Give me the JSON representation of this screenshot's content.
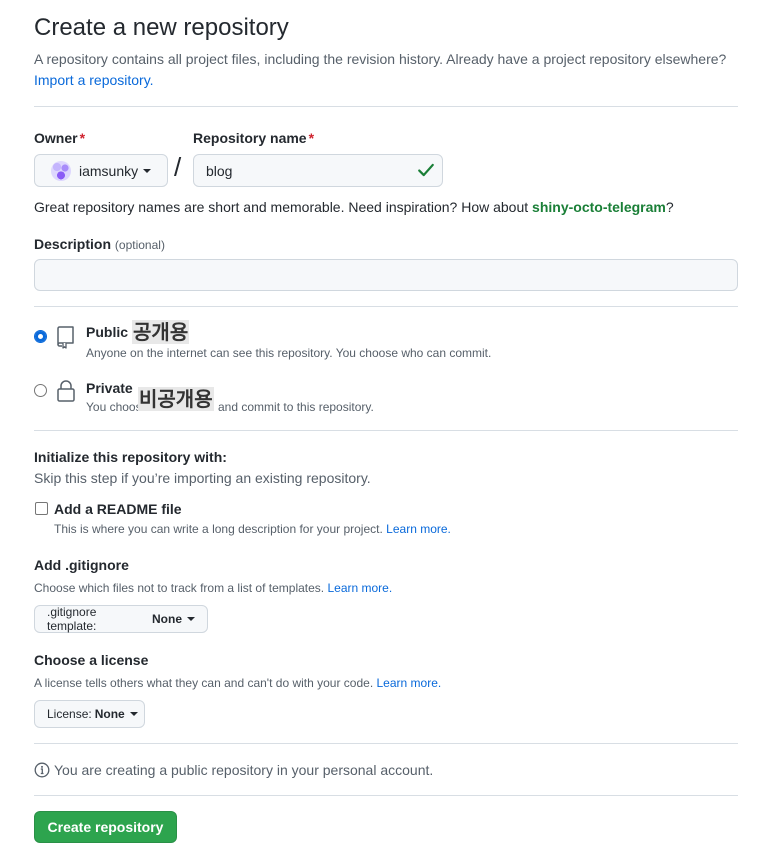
{
  "page": {
    "title": "Create a new repository",
    "subtitle": "A repository contains all project files, including the revision history. Already have a project repository elsewhere?",
    "import_link": "Import a repository."
  },
  "owner": {
    "label": "Owner",
    "required_mark": "*",
    "value": "iamsunky",
    "icon": "avatar"
  },
  "repo": {
    "separator": "/",
    "label": "Repository name",
    "required_mark": "*",
    "value": "blog",
    "valid_icon": "check-icon",
    "valid_color": "#1a7f37"
  },
  "name_hint": {
    "text": "Great repository names are short and memorable. Need inspiration? How about ",
    "suggestion": "shiny-octo-telegram",
    "end": "?"
  },
  "description": {
    "label": "Description",
    "optional": "(optional)",
    "value": ""
  },
  "visibility": {
    "options": [
      {
        "title": "Public",
        "overlay": "공개용",
        "desc": "Anyone on the internet can see this repository. You choose who can commit.",
        "selected": true,
        "icon": "repo-icon"
      },
      {
        "title": "Private",
        "overlay": "비공개용",
        "desc_before": "You choos",
        "desc_after": "and commit to this repository.",
        "selected": false,
        "icon": "lock-icon"
      }
    ]
  },
  "initialize": {
    "title": "Initialize this repository with:",
    "subtitle": "Skip this step if you’re importing an existing repository.",
    "readme": {
      "label": "Add a README file",
      "checked": false,
      "desc": "This is where you can write a long description for your project.",
      "learn_more": "Learn more."
    }
  },
  "gitignore": {
    "title": "Add .gitignore",
    "desc": "Choose which files not to track from a list of templates.",
    "learn_more": "Learn more.",
    "dropdown_label": ".gitignore template:",
    "dropdown_value": "None"
  },
  "license": {
    "title": "Choose a license",
    "desc": "A license tells others what they can and can't do with your code.",
    "learn_more": "Learn more.",
    "dropdown_label": "License:",
    "dropdown_value": "None"
  },
  "info": {
    "icon": "info-icon",
    "text": "You are creating a public repository in your personal account."
  },
  "submit": {
    "label": "Create repository",
    "color": "#2da44e"
  }
}
